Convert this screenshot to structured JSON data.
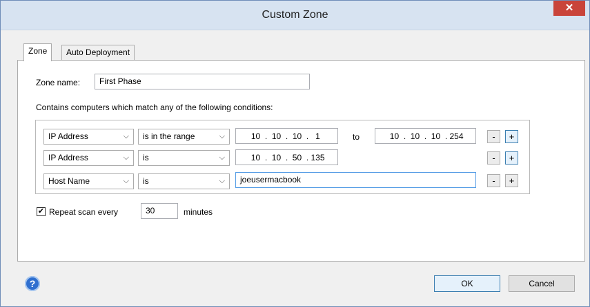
{
  "window": {
    "title": "Custom Zone",
    "close_glyph": "✕"
  },
  "tabs": [
    {
      "label": "Zone",
      "active": true
    },
    {
      "label": "Auto Deployment",
      "active": false
    }
  ],
  "zone": {
    "name_label": "Zone name:",
    "name_value": "First Phase",
    "conditions_text": "Contains computers which match any of the following conditions:"
  },
  "conditions": [
    {
      "field": "IP Address",
      "operator": "is in the range",
      "ip1": [
        "10",
        "10",
        "10",
        "1"
      ],
      "to_label": "to",
      "ip2": [
        "10",
        "10",
        "10",
        "254"
      ]
    },
    {
      "field": "IP Address",
      "operator": "is",
      "ip1": [
        "10",
        "10",
        "50",
        "135"
      ]
    },
    {
      "field": "Host Name",
      "operator": "is",
      "value": "joeusermacbook"
    }
  ],
  "row_buttons": {
    "minus": "-",
    "plus": "+"
  },
  "repeat": {
    "checked": true,
    "check_glyph": "✔",
    "label": "Repeat scan every",
    "value": "30",
    "unit": "minutes"
  },
  "footer": {
    "help_glyph": "?",
    "ok": "OK",
    "cancel": "Cancel"
  }
}
